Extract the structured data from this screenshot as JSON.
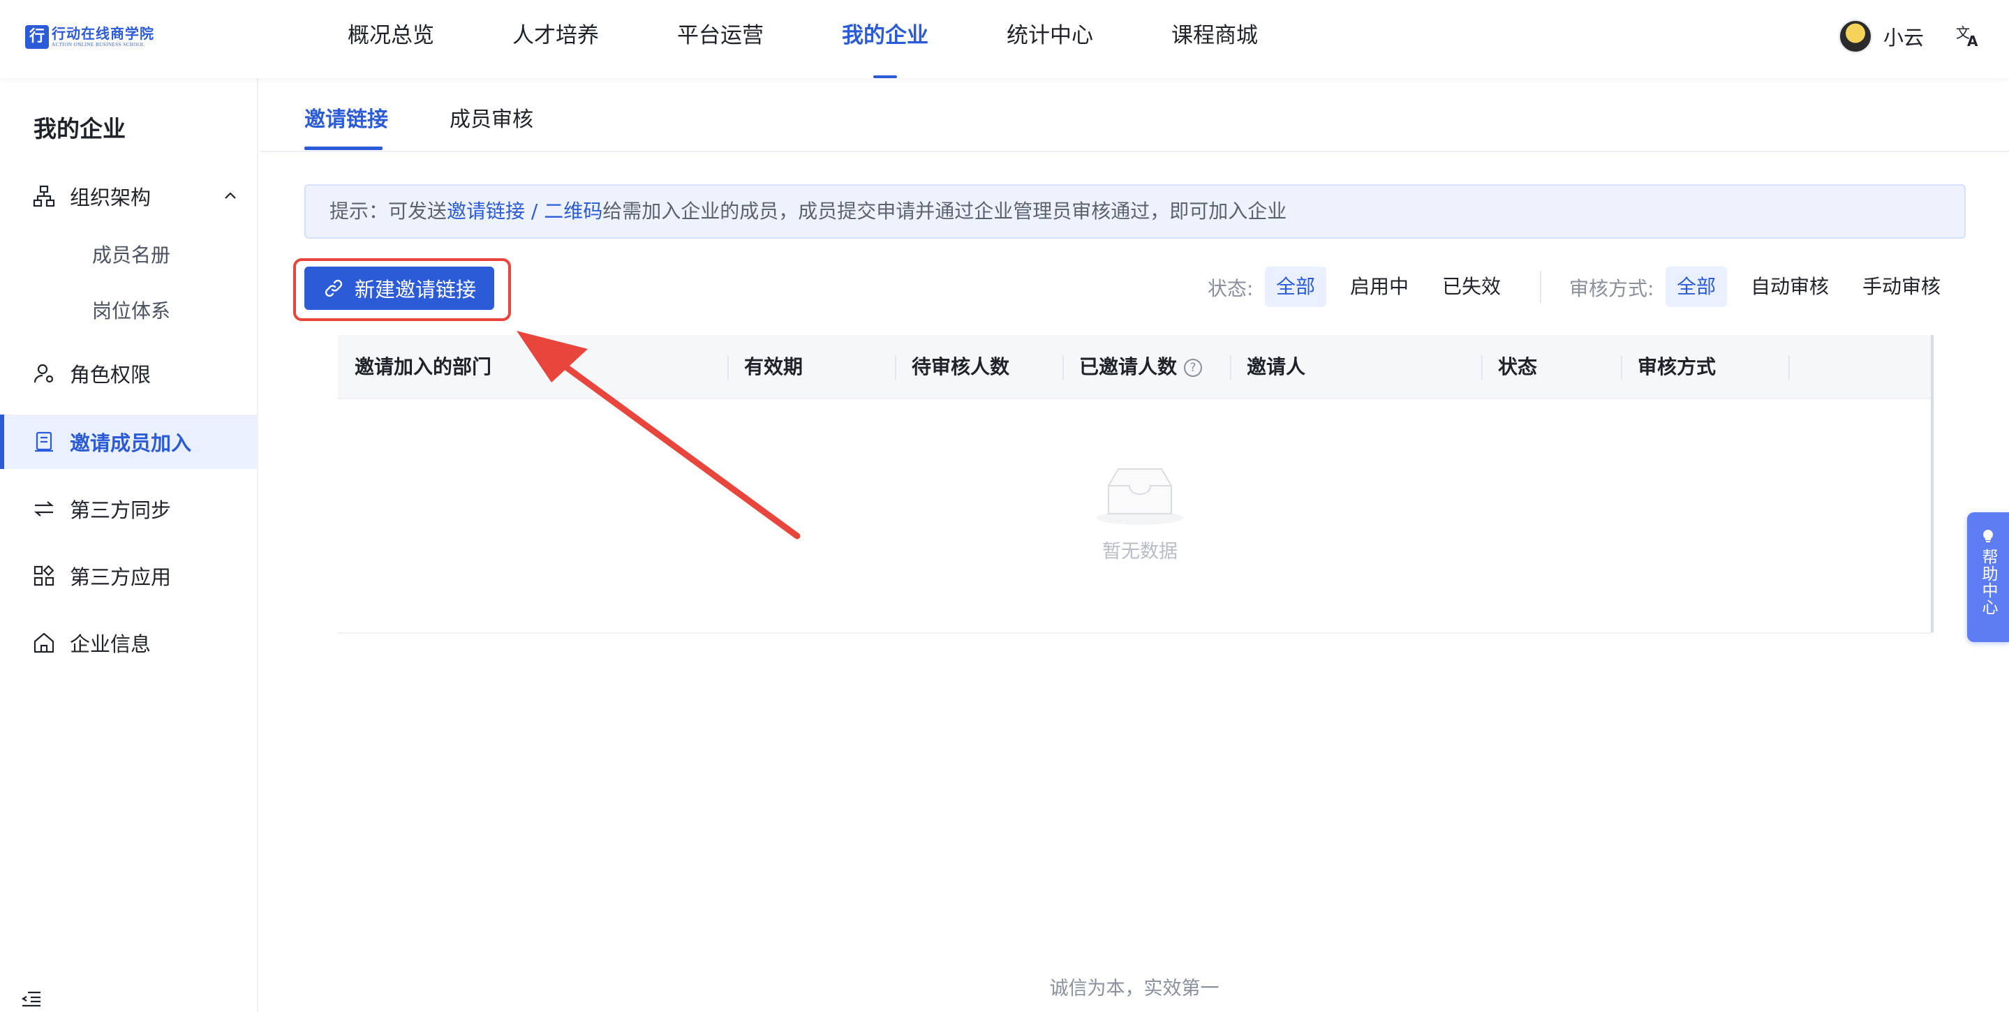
{
  "header": {
    "logo_cn": "行动在线商学院",
    "logo_en": "ACTION ONLINE BUSINESS SCHOOL",
    "nav": [
      {
        "label": "概况总览"
      },
      {
        "label": "人才培养"
      },
      {
        "label": "平台运营"
      },
      {
        "label": "我的企业",
        "active": true
      },
      {
        "label": "统计中心"
      },
      {
        "label": "课程商城"
      }
    ],
    "user_name": "小云"
  },
  "sidebar": {
    "title": "我的企业",
    "items": [
      {
        "label": "组织架构",
        "icon": "org-tree-icon",
        "expanded": true
      },
      {
        "label": "成员名册"
      },
      {
        "label": "岗位体系"
      },
      {
        "label": "角色权限",
        "icon": "user-role-icon"
      },
      {
        "label": "邀请成员加入",
        "icon": "invite-doc-icon",
        "active": true
      },
      {
        "label": "第三方同步",
        "icon": "sync-arrows-icon"
      },
      {
        "label": "第三方应用",
        "icon": "apps-grid-icon"
      },
      {
        "label": "企业信息",
        "icon": "home-icon"
      }
    ]
  },
  "tabs": [
    {
      "label": "邀请链接",
      "active": true
    },
    {
      "label": "成员审核"
    }
  ],
  "tip": {
    "prefix": "提示：可发送",
    "link": "邀请链接 / 二维码",
    "suffix": "给需加入企业的成员，成员提交申请并通过企业管理员审核通过，即可加入企业"
  },
  "toolbar": {
    "new_link_label": "新建邀请链接",
    "status_label": "状态:",
    "status_options": [
      "全部",
      "启用中",
      "已失效"
    ],
    "review_label": "审核方式:",
    "review_options": [
      "全部",
      "自动审核",
      "手动审核"
    ]
  },
  "table": {
    "columns": [
      "邀请加入的部门",
      "有效期",
      "待审核人数",
      "已邀请人数",
      "邀请人",
      "状态",
      "审核方式"
    ],
    "rows": [],
    "empty_text": "暂无数据"
  },
  "help_float": "帮助中心",
  "footer": "诚信为本，实效第一",
  "colors": {
    "accent": "#2c5bd8",
    "annotation_red": "#e8453c"
  }
}
